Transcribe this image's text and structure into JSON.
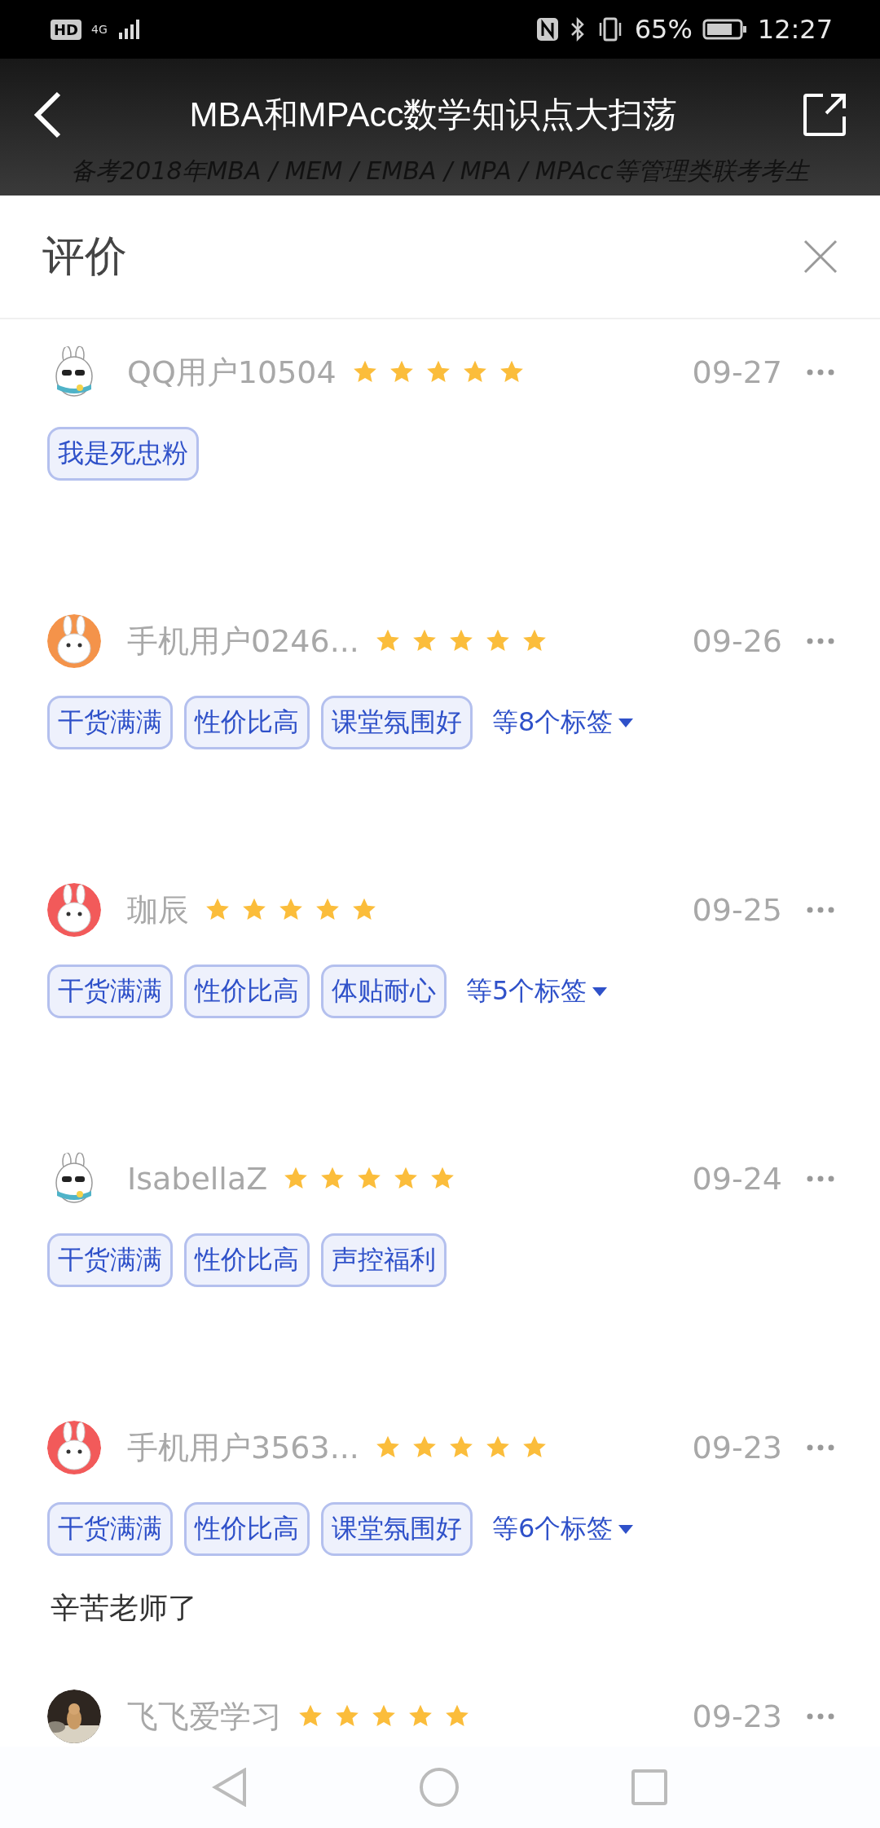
{
  "status_bar": {
    "hd_badge": "HD",
    "network": "4G",
    "battery": "65%",
    "time": "12:27"
  },
  "header": {
    "title": "MBA和MPAcc数学知识点大扫荡",
    "subtitle": "备考2018年MBA / MEM / EMBA / MPA / MPAcc等管理类联考考生"
  },
  "panel": {
    "title": "评价"
  },
  "reviews": [
    {
      "avatar": {
        "kind": "rabbit-sunglasses"
      },
      "user": "QQ用户10504",
      "stars": 5,
      "date": "09-27",
      "tags": [
        "我是死忠粉"
      ]
    },
    {
      "avatar": {
        "kind": "cartoon",
        "color": "#f4934a"
      },
      "user": "手机用户0246...",
      "stars": 5,
      "date": "09-26",
      "tags": [
        "干货满满",
        "性价比高",
        "课堂氛围好"
      ],
      "more_tags": "等8个标签"
    },
    {
      "avatar": {
        "kind": "cartoon",
        "color": "#f25a5a"
      },
      "user": "珈辰",
      "stars": 5,
      "date": "09-25",
      "tags": [
        "干货满满",
        "性价比高",
        "体贴耐心"
      ],
      "more_tags": "等5个标签"
    },
    {
      "avatar": {
        "kind": "rabbit-sunglasses"
      },
      "user": "IsabellaZ",
      "stars": 5,
      "date": "09-24",
      "tags": [
        "干货满满",
        "性价比高",
        "声控福利"
      ]
    },
    {
      "avatar": {
        "kind": "cartoon",
        "color": "#f25a5a"
      },
      "user": "手机用户3563...",
      "stars": 5,
      "date": "09-23",
      "tags": [
        "干货满满",
        "性价比高",
        "课堂氛围好"
      ],
      "more_tags": "等6个标签",
      "comment": "辛苦老师了"
    },
    {
      "user": "飞飞爱学习",
      "stars": 5,
      "date": "09-23"
    }
  ]
}
